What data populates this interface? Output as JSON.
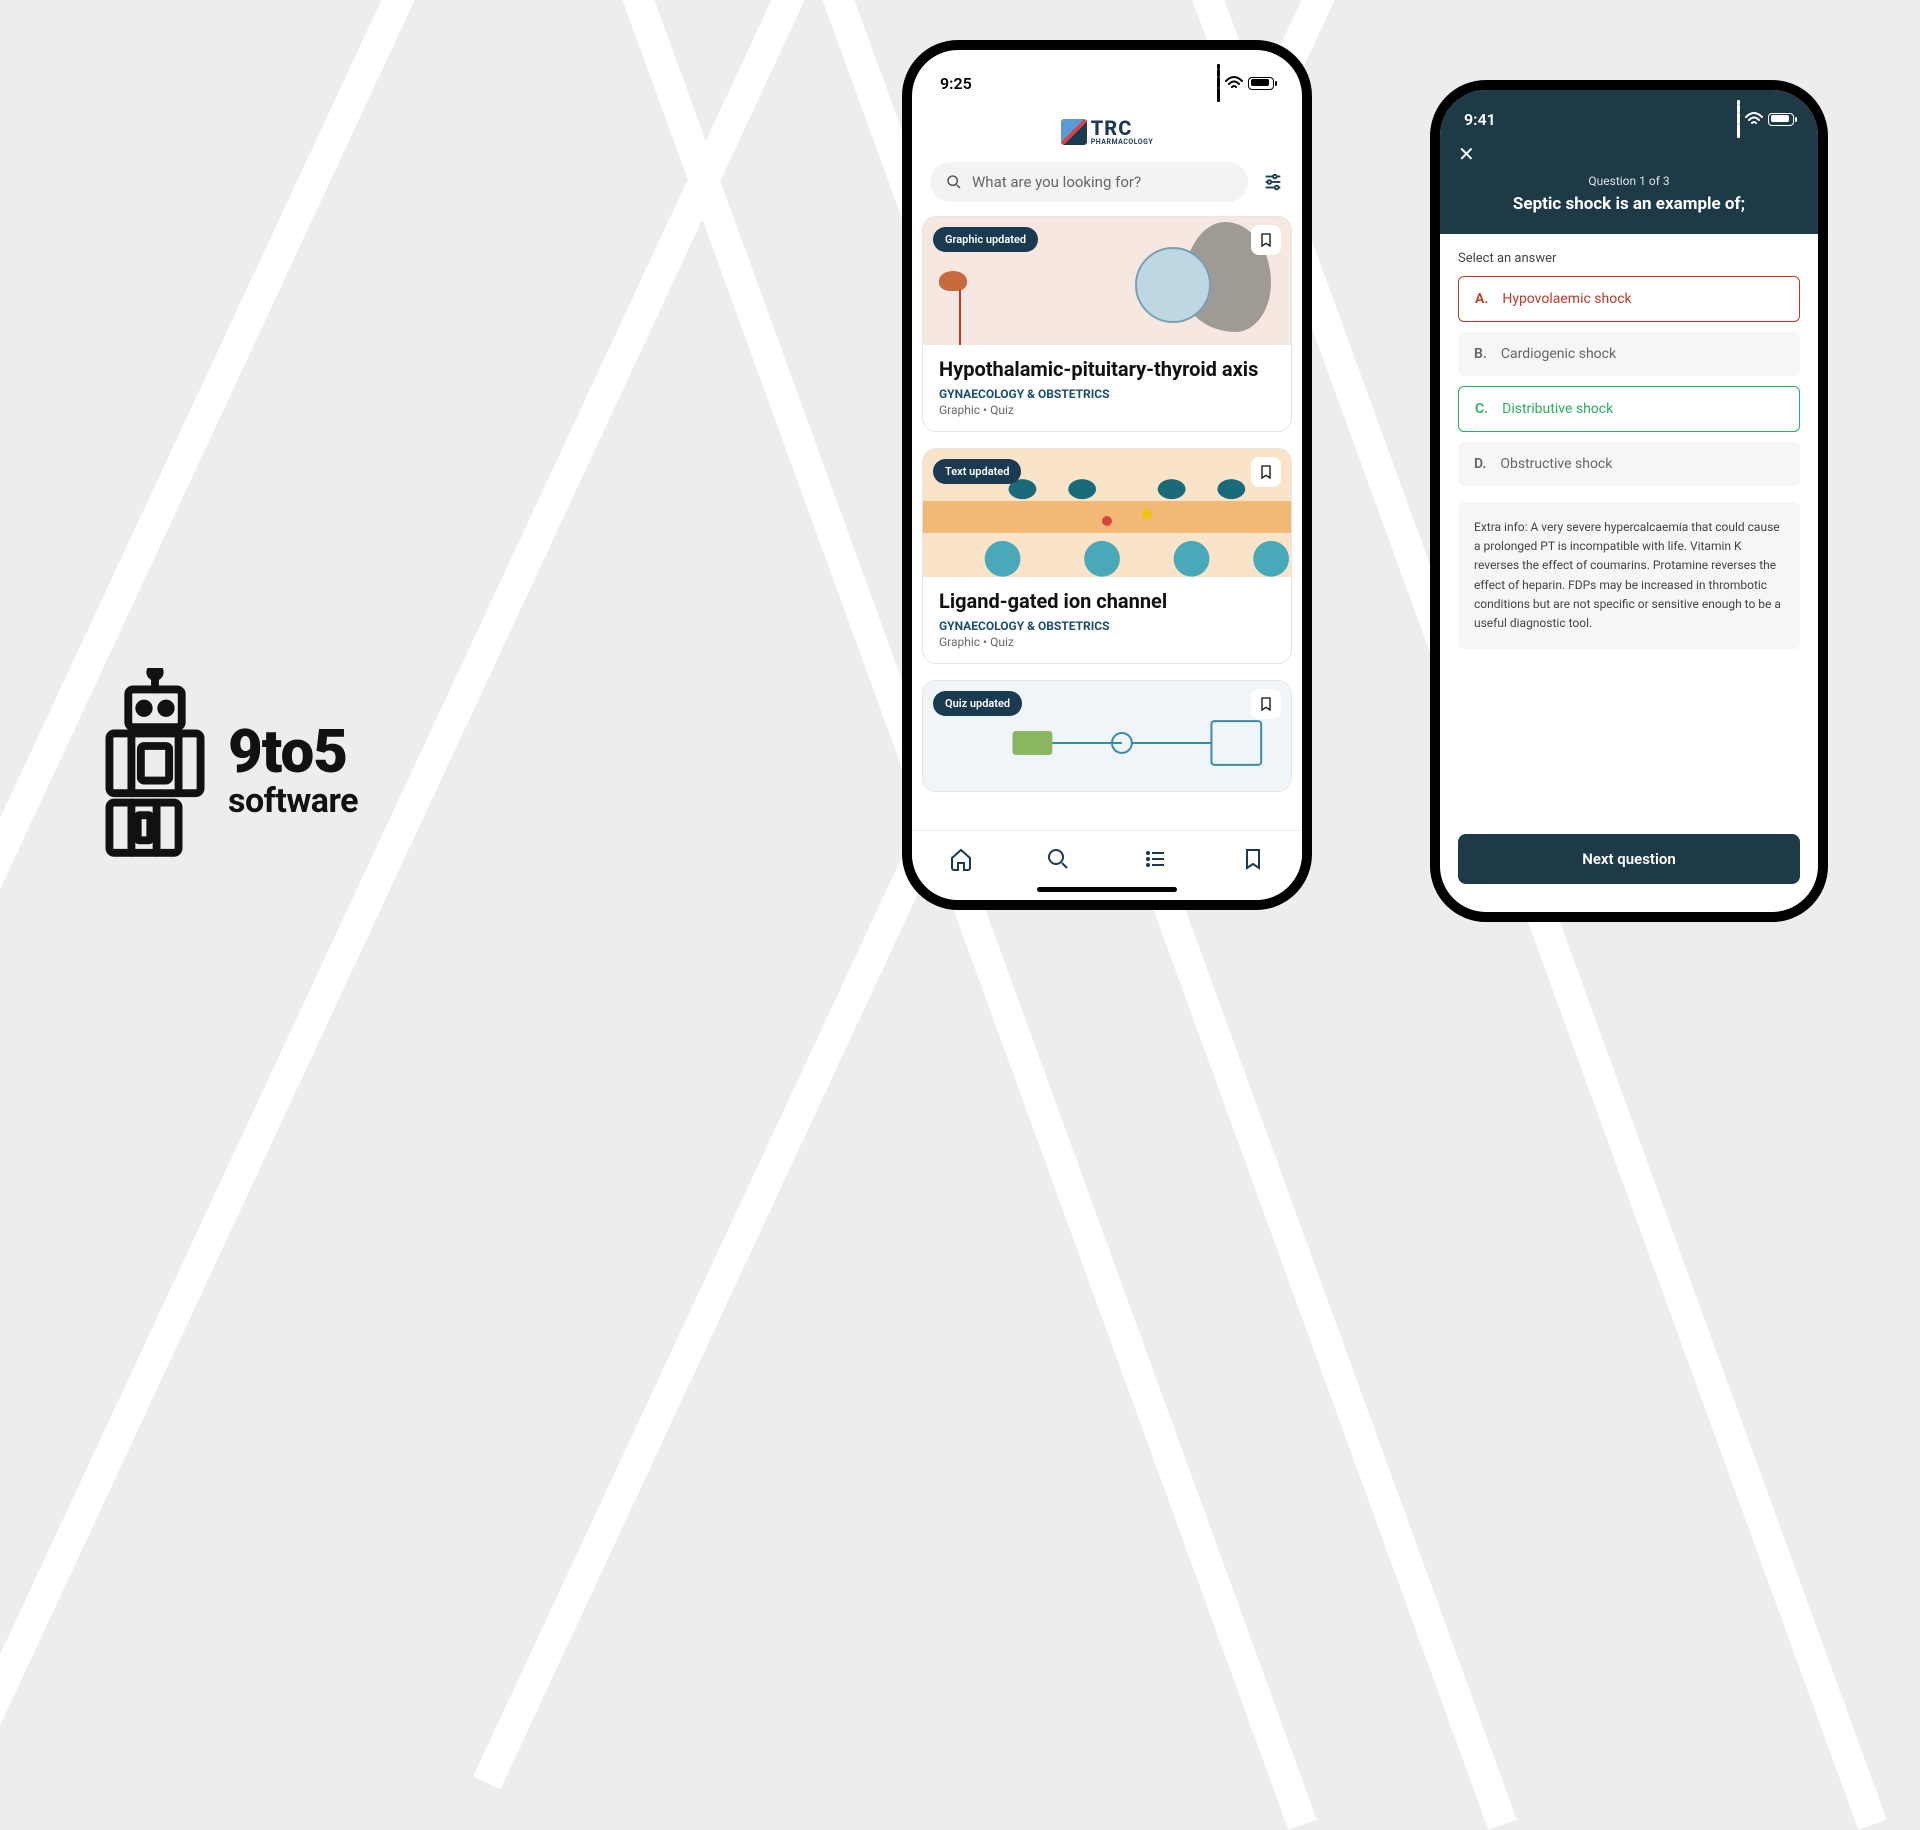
{
  "company": {
    "name": "9to5",
    "subtitle": "software"
  },
  "phone1": {
    "time": "9:25",
    "brand": {
      "main": "TRC",
      "sub": "PHARMACOLOGY"
    },
    "search": {
      "placeholder": "What are you looking for?"
    },
    "cards": [
      {
        "badge": "Graphic updated",
        "title": "Hypothalamic-pituitary-thyroid axis",
        "category": "GYNAECOLOGY & OBSTETRICS",
        "meta": "Graphic • Quiz"
      },
      {
        "badge": "Text updated",
        "title": "Ligand-gated ion channel",
        "category": "GYNAECOLOGY & OBSTETRICS",
        "meta": "Graphic • Quiz"
      },
      {
        "badge": "Quiz updated",
        "title": "",
        "category": "",
        "meta": ""
      }
    ]
  },
  "phone2": {
    "time": "9:41",
    "counter": "Question 1 of 3",
    "question": "Septic shock is an example of;",
    "select_label": "Select an answer",
    "answers": [
      {
        "letter": "A.",
        "text": "Hypovolaemic shock",
        "state": "wrong"
      },
      {
        "letter": "B.",
        "text": "Cardiogenic shock",
        "state": "default"
      },
      {
        "letter": "C.",
        "text": "Distributive shock",
        "state": "correct"
      },
      {
        "letter": "D.",
        "text": "Obstructive shock",
        "state": "default"
      }
    ],
    "extra": "Extra info: A very severe hypercalcaemia that could cause a prolonged PT is incompatible with life. Vitamin K reverses the effect of coumarins. Protamine reverses the effect of heparin. FDPs may be increased in thrombotic conditions but are not specific or sensitive enough to be a useful diagnostic tool.",
    "next": "Next question"
  }
}
